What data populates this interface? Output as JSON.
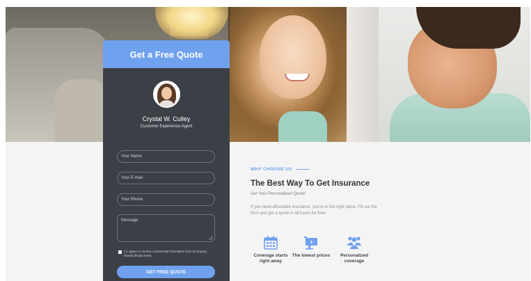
{
  "quote_form": {
    "title": "Get a Free Quote",
    "agent": {
      "name": "Crystal W. Culley",
      "role": "Customer Experience Agent"
    },
    "fields": {
      "name_placeholder": "Your Name",
      "email_placeholder": "Your E-mail",
      "phone_placeholder": "Your Phone",
      "message_placeholder": "Message"
    },
    "consent_text": "[ ] I agree to receive commercial information from [Company Name] [Read more]",
    "submit_label": "GET FREE QUOTE"
  },
  "content": {
    "eyebrow": "WHY CHOOSE US",
    "headline": "The Best Way To Get Insurance",
    "subhead": "Get Your Personalized Quote!",
    "body": "If you need affordable insurance, you're in the right place. Fill out the form and get a quote in all hours for free!"
  },
  "features": [
    {
      "icon": "calendar-icon",
      "label": "Coverage starts right away"
    },
    {
      "icon": "price-tag-icon",
      "label": "The lowest prices"
    },
    {
      "icon": "people-icon",
      "label": "Personalized coverage"
    }
  ],
  "colors": {
    "accent": "#6fa1ee",
    "card": "#3b4046",
    "text_dark": "#2f3237"
  }
}
